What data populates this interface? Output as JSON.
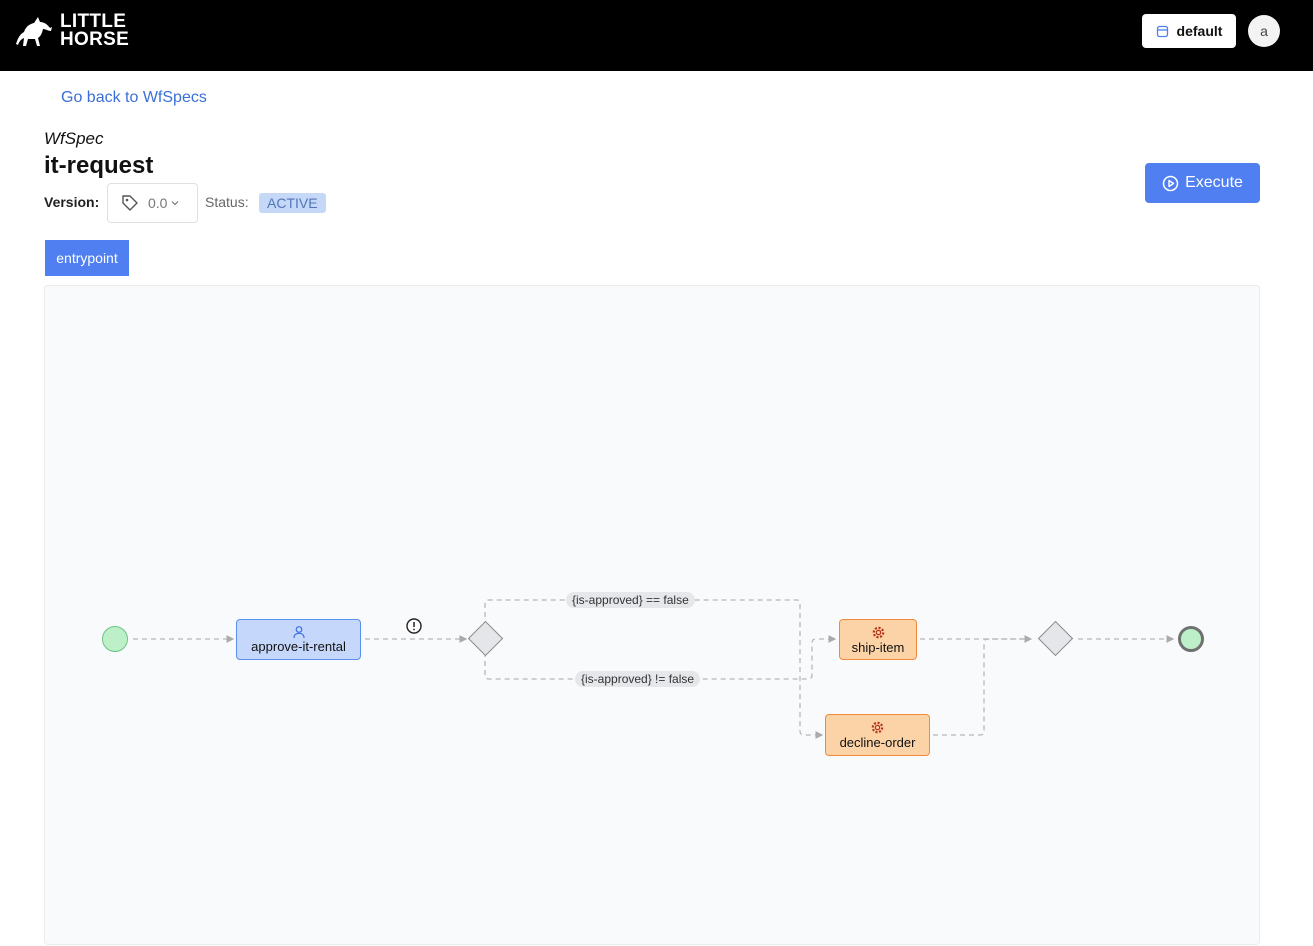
{
  "header": {
    "logo_line1": "LITTLE",
    "logo_line2": "HORSE",
    "tenant_label": "default",
    "avatar_initial": "a"
  },
  "page": {
    "back_link": "Go back to WfSpecs",
    "kind": "WfSpec",
    "title": "it-request",
    "version_label": "Version:",
    "version_value": "0.0",
    "status_label": "Status:",
    "status_value": "ACTIVE",
    "execute_label": "Execute"
  },
  "thread_tabs": [
    {
      "label": "entrypoint",
      "active": true
    }
  ],
  "diagram": {
    "nodes": {
      "user_task": {
        "label": "approve-it-rental",
        "icon": "user-icon"
      },
      "ship_task": {
        "label": "ship-item",
        "icon": "gear-icon"
      },
      "decline_task": {
        "label": "decline-order",
        "icon": "gear-icon"
      }
    },
    "edge_labels": {
      "false_branch": "{is-approved} == false",
      "not_false_branch": "{is-approved} != false"
    }
  },
  "colors": {
    "accent": "#4f7ff0",
    "user_task_fill": "#c5d8fc",
    "task_fill": "#fcd3a6",
    "start_fill": "#bdf0c8"
  }
}
